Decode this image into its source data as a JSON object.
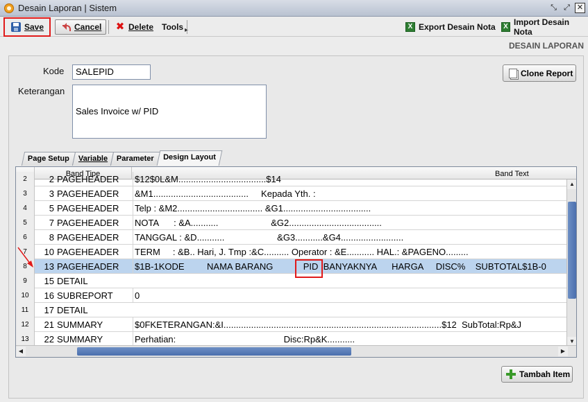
{
  "window": {
    "title": "Desain Laporan | Sistem"
  },
  "toolbar": {
    "save": "Save",
    "cancel": "Cancel",
    "delete": "Delete",
    "tools": "Tools",
    "export": "Export Desain Nota",
    "import": "Import Desain Nota"
  },
  "section_label": "DESAIN LAPORAN",
  "form": {
    "kode_label": "Kode",
    "kode_value": "SALEPID",
    "keterangan_label": "Keterangan",
    "keterangan_value": "Sales Invoice w/ PID",
    "clone_button": "Clone Report"
  },
  "tabs": [
    "Page Setup",
    "Variable",
    "Parameter",
    "Design Layout"
  ],
  "active_tab": "Design Layout",
  "grid": {
    "headers": {
      "band_tipe": "Band Tipe",
      "band_text": "Band Text"
    },
    "rows": [
      {
        "num": "2",
        "idx": "2",
        "type": "PAGEHEADER",
        "text": "$12$0L&M...................................$14"
      },
      {
        "num": "3",
        "idx": "3",
        "type": "PAGEHEADER",
        "text": "&M1......................................     Kepada Yth. :"
      },
      {
        "num": "4",
        "idx": "5",
        "type": "PAGEHEADER",
        "text": "Telp : &M2.................................. &G1..................................."
      },
      {
        "num": "5",
        "idx": "7",
        "type": "PAGEHEADER",
        "text": "NOTA      : &A...........                     &G2....................................."
      },
      {
        "num": "6",
        "idx": "8",
        "type": "PAGEHEADER",
        "text": "TANGGAL : &D...........                     &G3...........&G4........................."
      },
      {
        "num": "7",
        "idx": "10",
        "type": "PAGEHEADER",
        "text": "TERM     : &B.. Hari, J. Tmp :&C.......... Operator : &E........... HAL.: &PAGENO........."
      },
      {
        "num": "8",
        "idx": "13",
        "type": "PAGEHEADER",
        "text": "$1B-1KODE         NAMA BARANG            PID  BANYAKNYA      HARGA     DISC%    SUBTOTAL$1B-0"
      },
      {
        "num": "9",
        "idx": "15",
        "type": "DETAIL",
        "text": ""
      },
      {
        "num": "10",
        "idx": "16",
        "type": "SUBREPORT",
        "text": "0"
      },
      {
        "num": "11",
        "idx": "17",
        "type": "DETAIL",
        "text": ""
      },
      {
        "num": "12",
        "idx": "21",
        "type": "SUMMARY",
        "text": "$0FKETERANGAN:&I.......................................................................................$12  SubTotal:Rp&J"
      },
      {
        "num": "13",
        "idx": "22",
        "type": "SUMMARY",
        "text": "Perhatian:                                           Disc:Rp&K..........."
      }
    ]
  },
  "add_button": "Tambah Item"
}
